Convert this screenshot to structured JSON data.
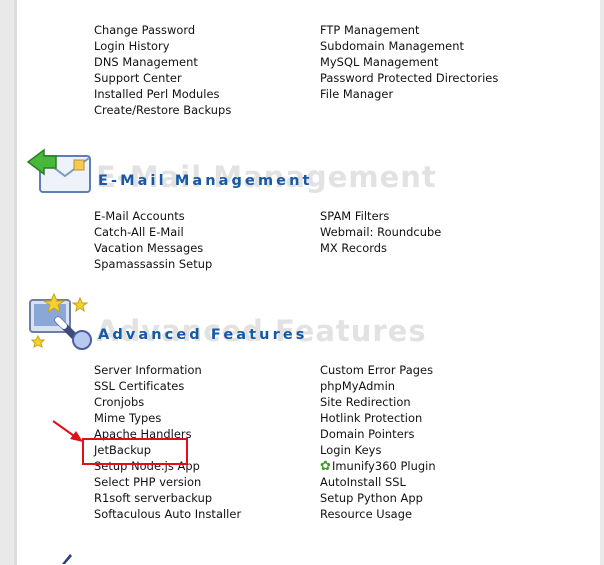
{
  "top_links": {
    "left": [
      "Change Password",
      "Login History",
      "DNS Management",
      "Support Center",
      "Installed Perl Modules",
      "Create/Restore Backups"
    ],
    "right": [
      "FTP Management",
      "Subdomain Management",
      "MySQL Management",
      "Password Protected Directories",
      "File Manager"
    ]
  },
  "email": {
    "title": "E-Mail Management",
    "ghost": "E-Mail Management",
    "icon": "envelope-arrow-icon",
    "left": [
      "E-Mail Accounts",
      "Catch-All E-Mail",
      "Vacation Messages",
      "Spamassassin Setup"
    ],
    "right": [
      "SPAM Filters",
      "Webmail: Roundcube",
      "MX Records"
    ]
  },
  "advanced": {
    "title": "Advanced Features",
    "ghost": "Advanced Features",
    "icon": "magic-wand-stars-icon",
    "left": [
      "Server Information",
      "SSL Certificates",
      "Cronjobs",
      "Mime Types",
      "Apache Handlers",
      "JetBackup",
      "Setup Node.js App",
      "Select PHP version",
      "R1soft serverbackup",
      "Softaculous Auto Installer"
    ],
    "right": [
      "Custom Error Pages",
      "phpMyAdmin",
      "Site Redirection",
      "Hotlink Protection",
      "Domain Pointers",
      "Login Keys",
      "Imunify360 Plugin",
      "AutoInstall SSL",
      "Setup Python App",
      "Resource Usage"
    ]
  },
  "colors": {
    "section_title": "#1559a8",
    "annotation": "#e01018",
    "imunify_gear": "#3b9c2e"
  },
  "icons": {
    "imunify": "gear-icon",
    "annotation_arrow": "red-arrow-icon",
    "annotation_box": "red-highlight-box"
  }
}
